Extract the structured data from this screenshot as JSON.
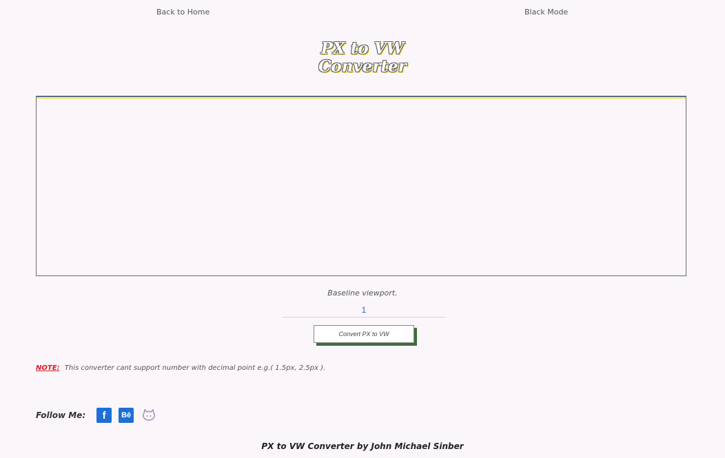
{
  "nav": {
    "back_label": "Back to Home",
    "mode_label": "Black Mode"
  },
  "title": {
    "line1": "PX to VW",
    "line2": "Converter"
  },
  "input": {
    "value": "",
    "placeholder": ""
  },
  "baseline": {
    "label": "Baseline viewport.",
    "value": "1"
  },
  "convert_button": {
    "label": "Convert PX to VW"
  },
  "note": {
    "label": "NOTE:",
    "text": "This converter cant support number with decimal point e.g.( 1.5px, 2.5px )."
  },
  "follow": {
    "label": "Follow Me:",
    "icons": [
      "facebook-icon",
      "behance-icon",
      "github-icon"
    ],
    "facebook_glyph": "f",
    "behance_glyph": "Bē"
  },
  "footer": {
    "text": "PX to VW Converter by John Michael Sinber"
  },
  "colors": {
    "accent_blue": "#1d6fd6",
    "note_red": "#d81b2b",
    "button_shadow": "#3f6b3f",
    "title_highlight": "#ffe94a"
  }
}
